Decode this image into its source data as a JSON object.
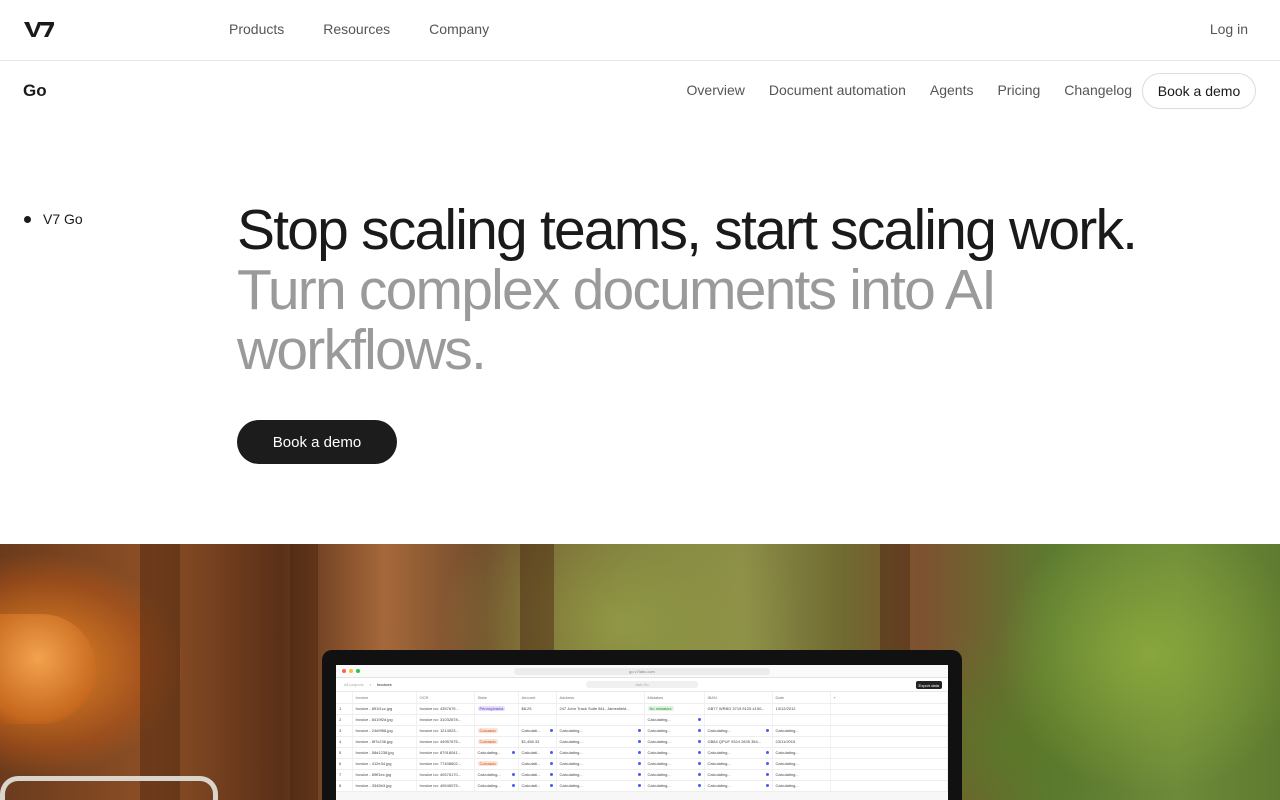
{
  "topnav": {
    "logo_text": "V7",
    "menu": [
      "Products",
      "Resources",
      "Company"
    ],
    "login": "Log in"
  },
  "subnav": {
    "brand": "Go",
    "links": [
      "Overview",
      "Document automation",
      "Agents",
      "Pricing",
      "Changelog"
    ],
    "cta": "Book a demo"
  },
  "side_label": "V7 Go",
  "hero": {
    "headline": "Stop scaling teams, start scaling work.",
    "subheadline": "Turn complex documents into AI workflows.",
    "cta": "Book a demo"
  },
  "screen": {
    "url": "go.v7labs.com",
    "breadcrumb_root": "All projects",
    "breadcrumb_current": "Invoices",
    "search_placeholder": "Ask Go",
    "export_label": "Export data",
    "columns": [
      "Invoice",
      "OCR",
      "State",
      "Amount",
      "Address",
      "Mistakes",
      "IBAN",
      "Date"
    ],
    "rows": [
      [
        "1",
        "Invoice - 891f1cc.jpg",
        "Invoice no: 4357679...",
        "Pennsylvania",
        "$8.25",
        "247 John Track Suite 841, Jamesfield...",
        "No mistakes",
        "GB77 WRBG 3715 5125 4150...",
        "13/12/2012"
      ],
      [
        "2",
        "Invoice - 8419f2d.jpg",
        "Invoice no: 31032678...",
        "",
        "",
        "",
        "Calculating...",
        "",
        ""
      ],
      [
        "3",
        "Invoice - 24d9f58.jpg",
        "Invoice no: 1214923...",
        "Colorado",
        "Calculati...",
        "Calculating...",
        "Calculating...",
        "Calculating...",
        "Calculating..."
      ],
      [
        "4",
        "Invoice - 8f7c236.jpg",
        "Invoice no: 44957675...",
        "Colorado",
        "$1,458.33",
        "Calculating...",
        "Calculating...",
        "GB84 QPUF 9324 2835 354...",
        "23/11/2015"
      ],
      [
        "5",
        "Invoice - 58d1238.jpg",
        "Invoice no: 87918041...",
        "Calculating...",
        "Calculati...",
        "Calculating...",
        "Calculating...",
        "Calculating...",
        "Calculating..."
      ],
      [
        "6",
        "Invoice - 412e34.jpg",
        "Invoice no: 77408602...",
        "Colorado",
        "Calculati...",
        "Calculating...",
        "Calculating...",
        "Calculating...",
        "Calculating..."
      ],
      [
        "7",
        "Invoice - 89ff1ec.jpg",
        "Invoice no: 40576170...",
        "Calculating...",
        "Calculati...",
        "Calculating...",
        "Calculating...",
        "Calculating...",
        "Calculating..."
      ],
      [
        "8",
        "Invoice - 3345b3.jpg",
        "Invoice no: 49545075...",
        "Calculating...",
        "Calculati...",
        "Calculating...",
        "Calculating...",
        "Calculating...",
        "Calculating..."
      ]
    ]
  },
  "colors": {
    "dark": "#1c1c1c",
    "muted_text": "#9a9a9a",
    "accent_blue": "#4b5cf0"
  }
}
